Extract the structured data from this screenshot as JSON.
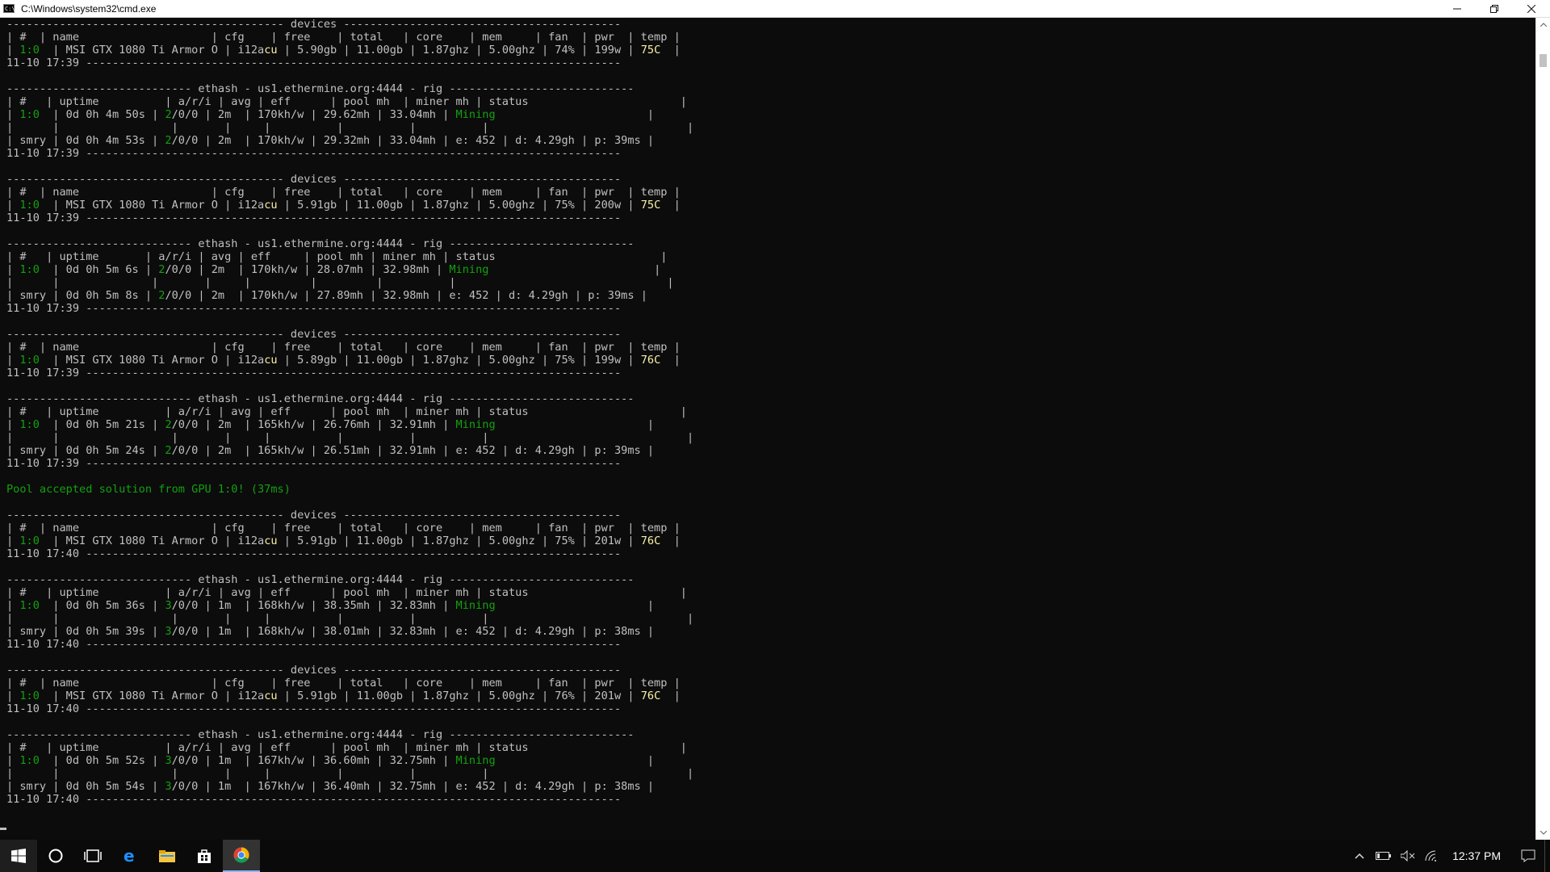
{
  "window": {
    "title": "C:\\Windows\\system32\\cmd.exe",
    "icon_text": "C:\\",
    "minimize_icon": "minimize-icon",
    "restore_icon": "restore-icon",
    "close_icon": "close-icon"
  },
  "colors": {
    "console_bg": "#0c0c0c",
    "console_text": "#c0c0c0",
    "highlight_green": "#13a10e",
    "highlight_yellow": "#f9f1a5"
  },
  "console": {
    "lines": [
      "------------------------------------------ devices ------------------------------------------",
      "| #  | name                    | cfg    | free    | total   | core    | mem     | fan  | pwr  | temp |",
      "| {g}1:0{/g}  | MSI GTX 1080 Ti Armor O | i12a{y}cu{/y} | 5.90gb | 11.00gb | 1.87ghz | 5.00ghz | 74% | 199w | {y}75C{/y}  |",
      "11-10 17:39 ---------------------------------------------------------------------------------",
      "",
      "---------------------------- ethash - us1.ethermine.org:4444 - rig ----------------------------",
      "| #   | uptime          | a/r/i | avg | eff      | pool mh  | miner mh | status                       |",
      "| {g}1:0{/g}  | 0d 0h 4m 50s | {g}2{/g}/0/0 | 2m  | 170kh/w | 29.62mh | 33.04mh | {g}Mining{/g}                       |",
      "|      |                 |       |     |          |          |          |                              |",
      "| smry | 0d 0h 4m 53s | {g}2{/g}/0/0 | 2m  | 170kh/w | 29.32mh | 33.04mh | e: 452 | d: 4.29gh | p: 39ms |",
      "11-10 17:39 ---------------------------------------------------------------------------------",
      "",
      "------------------------------------------ devices ------------------------------------------",
      "| #  | name                    | cfg    | free    | total   | core    | mem     | fan  | pwr  | temp |",
      "| {g}1:0{/g}  | MSI GTX 1080 Ti Armor O | i12a{y}cu{/y} | 5.91gb | 11.00gb | 1.87ghz | 5.00ghz | 75% | 200w | {y}75C{/y}  |",
      "11-10 17:39 ---------------------------------------------------------------------------------",
      "",
      "---------------------------- ethash - us1.ethermine.org:4444 - rig ----------------------------",
      "| #   | uptime       | a/r/i | avg | eff     | pool mh | miner mh | status                         |",
      "| {g}1:0{/g}  | 0d 0h 5m 6s | {g}2{/g}/0/0 | 2m  | 170kh/w | 28.07mh | 32.98mh | {g}Mining{/g}                         |",
      "|      |              |       |     |         |         |          |                                |",
      "| smry | 0d 0h 5m 8s | {g}2{/g}/0/0 | 2m  | 170kh/w | 27.89mh | 32.98mh | e: 452 | d: 4.29gh | p: 39ms |",
      "11-10 17:39 ---------------------------------------------------------------------------------",
      "",
      "------------------------------------------ devices ------------------------------------------",
      "| #  | name                    | cfg    | free    | total   | core    | mem     | fan  | pwr  | temp |",
      "| {g}1:0{/g}  | MSI GTX 1080 Ti Armor O | i12a{y}cu{/y} | 5.89gb | 11.00gb | 1.87ghz | 5.00ghz | 75% | 199w | {y}76C{/y}  |",
      "11-10 17:39 ---------------------------------------------------------------------------------",
      "",
      "---------------------------- ethash - us1.ethermine.org:4444 - rig ----------------------------",
      "| #   | uptime          | a/r/i | avg | eff      | pool mh  | miner mh | status                       |",
      "| {g}1:0{/g}  | 0d 0h 5m 21s | {g}2{/g}/0/0 | 2m  | 165kh/w | 26.76mh | 32.91mh | {g}Mining{/g}                       |",
      "|      |                 |       |     |          |          |          |                              |",
      "| smry | 0d 0h 5m 24s | {g}2{/g}/0/0 | 2m  | 165kh/w | 26.51mh | 32.91mh | e: 452 | d: 4.29gh | p: 39ms |",
      "11-10 17:39 ---------------------------------------------------------------------------------",
      "",
      "{g}Pool accepted solution from GPU 1:0! (37ms){/g}",
      "",
      "------------------------------------------ devices ------------------------------------------",
      "| #  | name                    | cfg    | free    | total   | core    | mem     | fan  | pwr  | temp |",
      "| {g}1:0{/g}  | MSI GTX 1080 Ti Armor O | i12a{y}cu{/y} | 5.91gb | 11.00gb | 1.87ghz | 5.00ghz | 75% | 201w | {y}76C{/y}  |",
      "11-10 17:40 ---------------------------------------------------------------------------------",
      "",
      "---------------------------- ethash - us1.ethermine.org:4444 - rig ----------------------------",
      "| #   | uptime          | a/r/i | avg | eff      | pool mh  | miner mh | status                       |",
      "| {g}1:0{/g}  | 0d 0h 5m 36s | {g}3{/g}/0/0 | 1m  | 168kh/w | 38.35mh | 32.83mh | {g}Mining{/g}                       |",
      "|      |                 |       |     |          |          |          |                              |",
      "| smry | 0d 0h 5m 39s | {g}3{/g}/0/0 | 1m  | 168kh/w | 38.01mh | 32.83mh | e: 452 | d: 4.29gh | p: 38ms |",
      "11-10 17:40 ---------------------------------------------------------------------------------",
      "",
      "------------------------------------------ devices ------------------------------------------",
      "| #  | name                    | cfg    | free    | total   | core    | mem     | fan  | pwr  | temp |",
      "| {g}1:0{/g}  | MSI GTX 1080 Ti Armor O | i12a{y}cu{/y} | 5.91gb | 11.00gb | 1.87ghz | 5.00ghz | 76% | 201w | {y}76C{/y}  |",
      "11-10 17:40 ---------------------------------------------------------------------------------",
      "",
      "---------------------------- ethash - us1.ethermine.org:4444 - rig ----------------------------",
      "| #   | uptime          | a/r/i | avg | eff      | pool mh  | miner mh | status                       |",
      "| {g}1:0{/g}  | 0d 0h 5m 52s | {g}3{/g}/0/0 | 1m  | 167kh/w | 36.60mh | 32.75mh | {g}Mining{/g}                       |",
      "|      |                 |       |     |          |          |          |                              |",
      "| smry | 0d 0h 5m 54s | {g}3{/g}/0/0 | 1m  | 167kh/w | 36.40mh | 32.75mh | e: 452 | d: 4.29gh | p: 38ms |",
      "11-10 17:40 ---------------------------------------------------------------------------------"
    ]
  },
  "scrollbar": {
    "up_icon": "scroll-up-arrow-icon",
    "down_icon": "scroll-down-arrow-icon"
  },
  "taskbar": {
    "start_icon": "windows-start-icon",
    "cortana_icon": "cortana-circle-icon",
    "task_view_icon": "task-view-icon",
    "edge_icon": "edge-icon",
    "explorer_icon": "file-explorer-icon",
    "store_icon": "store-icon",
    "chrome_icon": "chrome-icon",
    "tray_icons": [
      "chevron-up-icon",
      "battery-icon",
      "speaker-muted-icon",
      "wifi-icon"
    ],
    "clock": "12:37 PM",
    "notification_icon": "action-center-icon"
  }
}
